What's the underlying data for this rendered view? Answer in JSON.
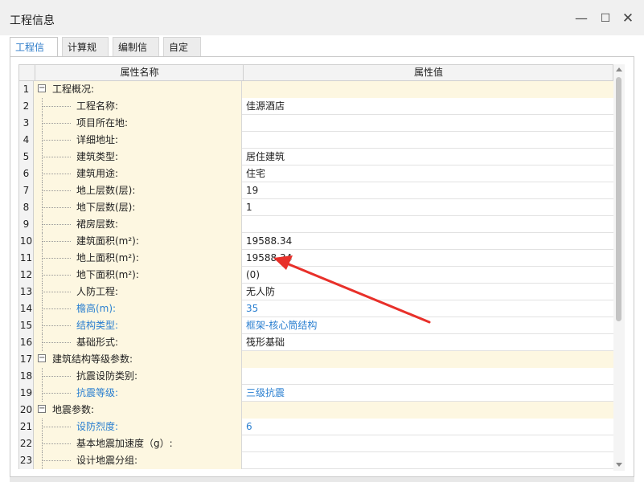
{
  "window": {
    "title": "工程信息",
    "minimize_icon": "minimize-icon",
    "maximize_icon": "maximize-icon",
    "close_icon": "close-icon"
  },
  "tabs": [
    {
      "label": "工程信息",
      "active": true
    },
    {
      "label": "计算规则",
      "active": false
    },
    {
      "label": "编制信息",
      "active": false
    },
    {
      "label": "自定义",
      "active": false
    }
  ],
  "grid": {
    "header": {
      "name": "属性名称",
      "value": "属性值"
    },
    "rows": [
      {
        "num": "1",
        "name": "工程概况:",
        "value": "",
        "group": true,
        "blue": false
      },
      {
        "num": "2",
        "name": "工程名称:",
        "value": "佳源酒店",
        "group": false,
        "blue": false
      },
      {
        "num": "3",
        "name": "项目所在地:",
        "value": "",
        "group": false,
        "blue": false
      },
      {
        "num": "4",
        "name": "详细地址:",
        "value": "",
        "group": false,
        "blue": false
      },
      {
        "num": "5",
        "name": "建筑类型:",
        "value": "居住建筑",
        "group": false,
        "blue": false
      },
      {
        "num": "6",
        "name": "建筑用途:",
        "value": "住宅",
        "group": false,
        "blue": false
      },
      {
        "num": "7",
        "name": "地上层数(层):",
        "value": "19",
        "group": false,
        "blue": false
      },
      {
        "num": "8",
        "name": "地下层数(层):",
        "value": "1",
        "group": false,
        "blue": false
      },
      {
        "num": "9",
        "name": "裙房层数:",
        "value": "",
        "group": false,
        "blue": false
      },
      {
        "num": "10",
        "name": "建筑面积(m²):",
        "value": "19588.34",
        "group": false,
        "blue": false
      },
      {
        "num": "11",
        "name": "地上面积(m²):",
        "value": "19588.34",
        "group": false,
        "blue": false
      },
      {
        "num": "12",
        "name": "地下面积(m²):",
        "value": "(0)",
        "group": false,
        "blue": false
      },
      {
        "num": "13",
        "name": "人防工程:",
        "value": "无人防",
        "group": false,
        "blue": false
      },
      {
        "num": "14",
        "name": "檐高(m):",
        "value": "35",
        "group": false,
        "blue": true
      },
      {
        "num": "15",
        "name": "结构类型:",
        "value": "框架-核心筒结构",
        "group": false,
        "blue": true
      },
      {
        "num": "16",
        "name": "基础形式:",
        "value": "筏形基础",
        "group": false,
        "blue": false
      },
      {
        "num": "17",
        "name": "建筑结构等级参数:",
        "value": "",
        "group": true,
        "blue": false
      },
      {
        "num": "18",
        "name": "抗震设防类别:",
        "value": "",
        "group": false,
        "blue": false
      },
      {
        "num": "19",
        "name": "抗震等级:",
        "value": "三级抗震",
        "group": false,
        "blue": true
      },
      {
        "num": "20",
        "name": "地震参数:",
        "value": "",
        "group": true,
        "blue": false
      },
      {
        "num": "21",
        "name": "设防烈度:",
        "value": "6",
        "group": false,
        "blue": true
      },
      {
        "num": "22",
        "name": "基本地震加速度（g）:",
        "value": "",
        "group": false,
        "blue": false
      },
      {
        "num": "23",
        "name": "设计地震分组:",
        "value": "",
        "group": false,
        "blue": false
      }
    ]
  },
  "colors": {
    "accent": "#2a7fd0",
    "name_bg": "#fdf7e1",
    "arrow": "#e8302a"
  },
  "annotation": {
    "type": "red-arrow",
    "points_to": "row 11 value"
  }
}
